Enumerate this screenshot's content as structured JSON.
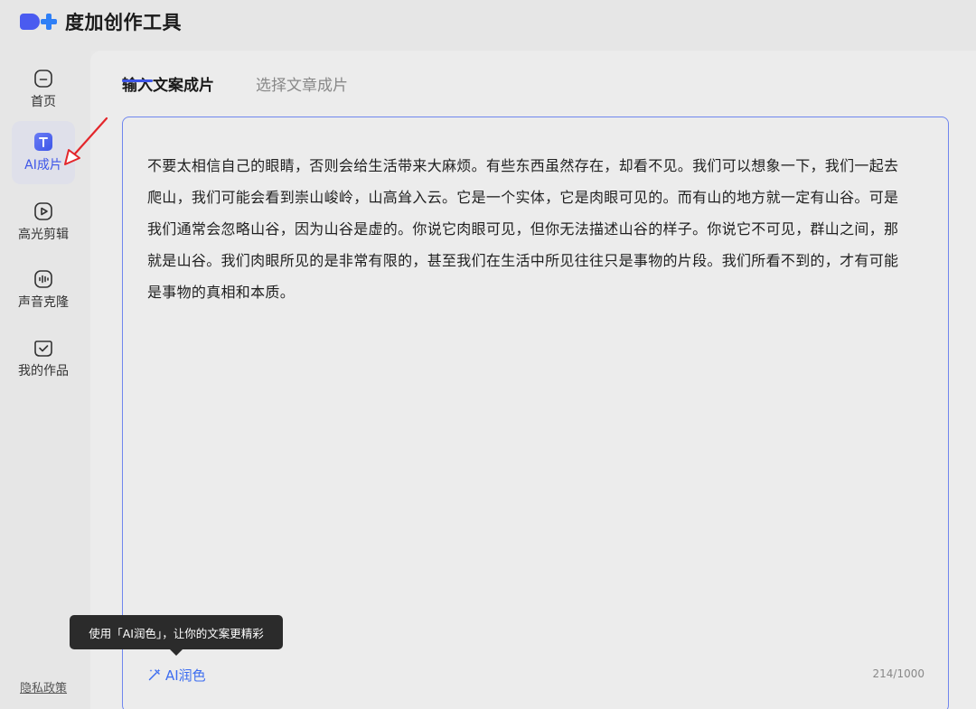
{
  "app": {
    "title": "度加创作工具",
    "brand_colors": {
      "logo_blob": "#4a5bf0",
      "logo_plus": "#2f7ff6",
      "accent": "#3d55e8"
    }
  },
  "sidebar": {
    "items": [
      {
        "label": "首页",
        "icon": "home-icon",
        "active": false
      },
      {
        "label": "AI成片",
        "icon": "text-to-video-icon",
        "active": true
      },
      {
        "label": "高光剪辑",
        "icon": "play-icon",
        "active": false
      },
      {
        "label": "声音克隆",
        "icon": "voice-wave-icon",
        "active": false
      },
      {
        "label": "我的作品",
        "icon": "works-check-icon",
        "active": false
      }
    ],
    "privacy_label": "隐私政策"
  },
  "main": {
    "tabs": [
      {
        "label": "输入文案成片",
        "active": true
      },
      {
        "label": "选择文章成片",
        "active": false
      }
    ],
    "editor": {
      "text": "不要太相信自己的眼睛，否则会给生活带来大麻烦。有些东西虽然存在，却看不见。我们可以想象一下，我们一起去爬山，我们可能会看到崇山峻岭，山高耸入云。它是一个实体，它是肉眼可见的。而有山的地方就一定有山谷。可是我们通常会忽略山谷，因为山谷是虚的。你说它肉眼可见，但你无法描述山谷的样子。你说它不可见，群山之间，那就是山谷。我们肉眼所见的是非常有限的，甚至我们在生活中所见往往只是事物的片段。我们所看不到的，才有可能是事物的真相和本质。",
      "polish_label": "AI润色",
      "char_count": "214/1000"
    },
    "tooltip": "使用「AI润色」，让你的文案更精彩"
  }
}
